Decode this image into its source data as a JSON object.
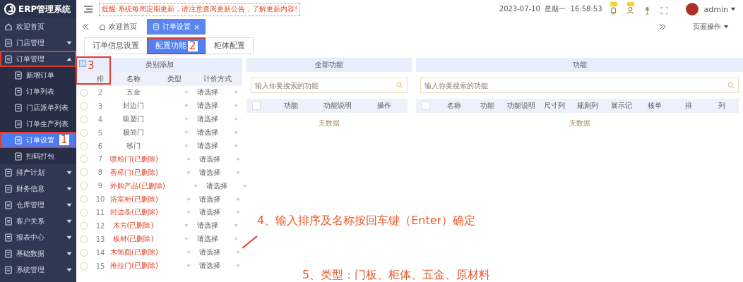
{
  "app": {
    "logo_text": "ERP管理系统"
  },
  "sidebar": {
    "items": [
      {
        "label": "欢迎首页",
        "kind": "home",
        "selected": false
      },
      {
        "label": "门店管理",
        "kind": "group",
        "selected": false,
        "expanded": false
      },
      {
        "label": "订单管理",
        "kind": "group",
        "selected": false,
        "expanded": true,
        "highlighted": true,
        "children": [
          {
            "label": "新增订单",
            "kind": "child",
            "selected": false
          },
          {
            "label": "订单列表",
            "kind": "child",
            "selected": false
          },
          {
            "label": "门店派单列表",
            "kind": "child",
            "selected": false
          },
          {
            "label": "订单生产列表",
            "kind": "child",
            "selected": false
          },
          {
            "label": "订单设置",
            "kind": "child",
            "selected": true,
            "highlighted": true,
            "callout": "1"
          },
          {
            "label": "扫码打包",
            "kind": "child",
            "selected": false
          }
        ]
      },
      {
        "label": "排产计划",
        "kind": "group",
        "selected": false,
        "expanded": false
      },
      {
        "label": "财务信息",
        "kind": "group",
        "selected": false,
        "expanded": false
      },
      {
        "label": "仓库管理",
        "kind": "group",
        "selected": false,
        "expanded": false
      },
      {
        "label": "客户关系",
        "kind": "group",
        "selected": false,
        "expanded": false
      },
      {
        "label": "报表中心",
        "kind": "group",
        "selected": false,
        "expanded": false
      },
      {
        "label": "基础数据",
        "kind": "group",
        "selected": false,
        "expanded": false
      },
      {
        "label": "系统管理",
        "kind": "group",
        "selected": false,
        "expanded": false
      }
    ]
  },
  "header": {
    "notice": "提醒:系统每周定期更新，请注意查阅更新公告，了解更新内容!",
    "datetime": "2023-07-10  星期一  16:58:53",
    "user": "admin"
  },
  "tabs": [
    {
      "label": "欢迎首页",
      "selected": false
    },
    {
      "label": "订单设置",
      "selected": true,
      "close": "×"
    }
  ],
  "page_actions": "页面操作",
  "subtabs": [
    {
      "label": "订单信息设置",
      "selected": false
    },
    {
      "label": "配置功能",
      "selected": true,
      "highlighted": true,
      "callout": "2"
    },
    {
      "label": "柜体配置",
      "selected": false
    }
  ],
  "category_panel": {
    "title": "类别添加",
    "header_checkbox": {
      "checked": false,
      "highlighted": true,
      "callout": "3"
    },
    "columns": [
      "排",
      "名称",
      "类型",
      "计价方式"
    ],
    "rows": [
      {
        "sort": "2",
        "name": "五金",
        "deleted": false,
        "selected": false,
        "pricing": "请选择"
      },
      {
        "sort": "3",
        "name": "封边门",
        "deleted": false,
        "selected": false,
        "pricing": "请选择"
      },
      {
        "sort": "4",
        "name": "吸塑门",
        "deleted": false,
        "selected": false,
        "pricing": "请选择"
      },
      {
        "sort": "5",
        "name": "极简门",
        "deleted": false,
        "selected": false,
        "pricing": "请选择"
      },
      {
        "sort": "6",
        "name": "移门",
        "deleted": false,
        "selected": false,
        "pricing": "请选择"
      },
      {
        "sort": "7",
        "name": "喷粉门(已删除)",
        "deleted": true,
        "selected": false,
        "pricing": "请选择"
      },
      {
        "sort": "8",
        "name": "香樟门(已删除)",
        "deleted": true,
        "selected": false,
        "pricing": "请选择"
      },
      {
        "sort": "9",
        "name": "外购产品(已删除)",
        "deleted": true,
        "selected": false,
        "pricing": "请选择"
      },
      {
        "sort": "10",
        "name": "浴室柜(已删除)",
        "deleted": true,
        "selected": false,
        "pricing": "请选择"
      },
      {
        "sort": "11",
        "name": "封边条(已删除)",
        "deleted": true,
        "selected": false,
        "pricing": "请选择"
      },
      {
        "sort": "12",
        "name": "木方(已删除)",
        "deleted": true,
        "selected": false,
        "pricing": "请选择"
      },
      {
        "sort": "13",
        "name": "板材(已删除)",
        "deleted": true,
        "selected": false,
        "pricing": "请选择"
      },
      {
        "sort": "14",
        "name": "木饰面(已删除)",
        "deleted": true,
        "selected": false,
        "pricing": "请选择"
      },
      {
        "sort": "15",
        "name": "推拉门(已删除)",
        "deleted": true,
        "selected": false,
        "pricing": "请选择"
      }
    ]
  },
  "all_functions_panel": {
    "title": "全部功能",
    "search_placeholder": "输入你要搜索的功能",
    "header_checked": false,
    "columns": [
      "功能",
      "功能说明",
      "操作"
    ],
    "empty_text": "无数据"
  },
  "functions_panel": {
    "title": "功能",
    "search_placeholder": "输入你要搜索的功能",
    "header_checked": false,
    "columns": [
      "名称",
      "功能",
      "功能说明",
      "尺寸列",
      "规则列",
      "展示记",
      "核单",
      "排",
      "列"
    ],
    "empty_text": "无数据"
  },
  "annotations": [
    {
      "text": "4、输入排序及名称按回车键（Enter）确定"
    },
    {
      "text": "5、类型：门板、柜体、五金、原材料"
    }
  ]
}
